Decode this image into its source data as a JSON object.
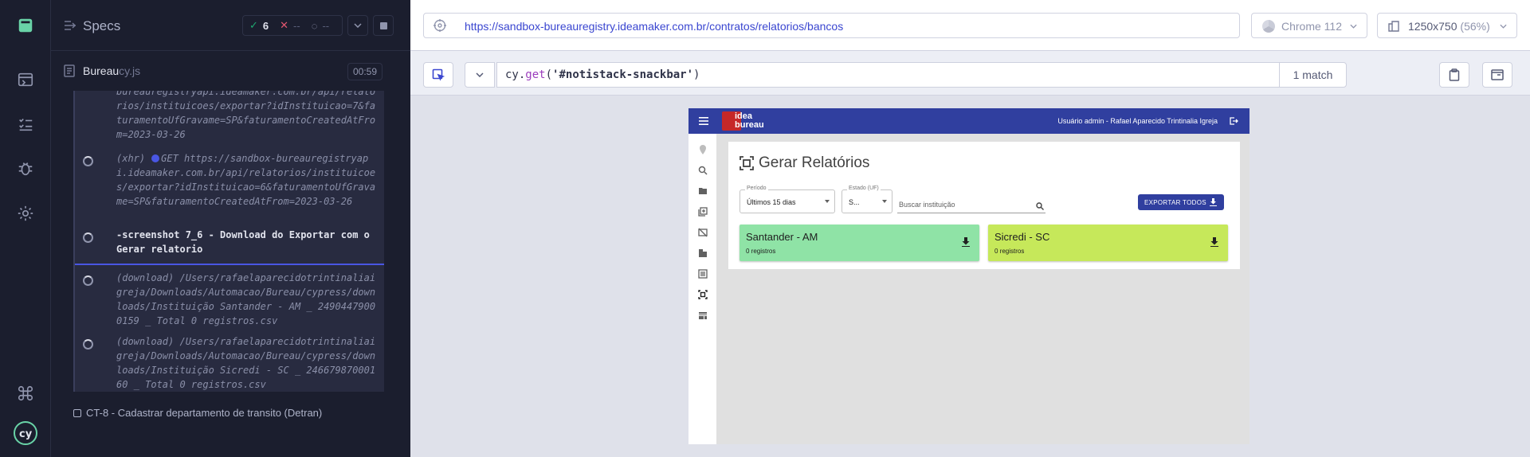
{
  "reporter": {
    "header": {
      "specs_label": "Specs",
      "passed_count": "6",
      "failed_count": "--",
      "pending_count": "--"
    },
    "file": {
      "name": "Bureau",
      "ext": "cy.js",
      "duration": "00:59"
    },
    "commands": [
      {
        "text": "bureauregistryapi.ideamaker.com.br/api/relatorios/instituicoes/exportar?idInstituicao=7&faturamentoUfGravame=SP&faturamentoCreatedAtFrom=2023-03-26"
      },
      {
        "prefix": "(xhr)",
        "method": "GET",
        "text": "https://sandbox-bureauregistryapi.ideamaker.com.br/api/relatorios/instituicoes/exportar?idInstituicao=6&faturamentoUfGravame=SP&faturamentoCreatedAtFrom=2023-03-26"
      },
      {
        "text": "-screenshot  7_6 - Download do Exportar com o Gerar relatorio"
      },
      {
        "prefix": "(download)",
        "text": "/Users/rafaelaparecidotrintinaliaigreja/Downloads/Automacao/Bureau/cypress/downloads/Instituição Santander - AM _ 24904479000159 _ Total 0 registros.csv"
      },
      {
        "prefix": "(download)",
        "text": "/Users/rafaelaparecidotrintinaliaigreja/Downloads/Automacao/Bureau/cypress/downloads/Instituição Sicredi - SC _ 24667987000160 _ Total 0 registros.csv"
      }
    ],
    "next_test": "CT-8 - Cadastrar departamento de transito (Detran)"
  },
  "aut": {
    "url": "https://sandbox-bureauregistry.ideamaker.com.br/contratos/relatorios/bancos",
    "browser": "Chrome 112",
    "viewport": "1250x750",
    "viewport_scale": "(56%)",
    "selector_fn": "get",
    "selector_prefix": "cy.",
    "selector_arg": "'#notistack-snackbar'",
    "match_count": "1 match"
  },
  "app": {
    "logo_line1": "idea",
    "logo_line2": "bureau",
    "user": "Usuário admin -  Rafael Aparecido Trintinalia Igreja",
    "page_title": "Gerar Relatórios",
    "periodo_label": "Período",
    "periodo_value": "Últimos 15 dias",
    "estado_label": "Estado (UF)",
    "estado_value": "S...",
    "search_placeholder": "Buscar instituição",
    "export_label": "EXPORTAR TODOS",
    "banks": [
      {
        "name": "Santander - AM",
        "records": "0 registros",
        "color": "#8fe3a6"
      },
      {
        "name": "Sicredi - SC",
        "records": "0 registros",
        "color": "#c6e85a"
      }
    ]
  }
}
